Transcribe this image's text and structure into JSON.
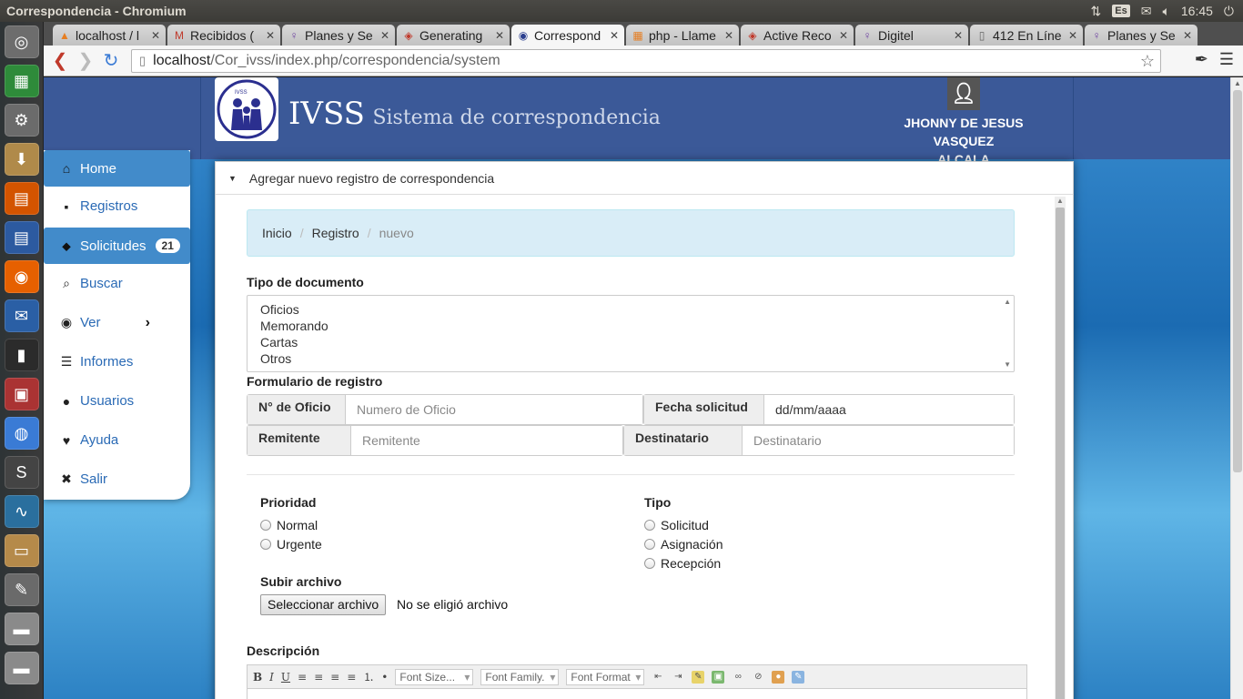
{
  "os": {
    "window_title": "Correspondencia - Chromium",
    "keyboard_layout": "Es",
    "clock": "16:45"
  },
  "launcher": {
    "items": [
      {
        "name": "ubuntu-dash-icon",
        "glyph": "◎",
        "color": "#6d6d6d"
      },
      {
        "name": "spreadsheet-icon",
        "glyph": "▦",
        "color": "#2e8b3a"
      },
      {
        "name": "settings-icon",
        "glyph": "⚙",
        "color": "#6b6b6b"
      },
      {
        "name": "files-download-icon",
        "glyph": "⬇",
        "color": "#b08a4a"
      },
      {
        "name": "presentation-icon",
        "glyph": "▤",
        "color": "#d35400"
      },
      {
        "name": "writer-icon",
        "glyph": "▤",
        "color": "#2c5aa0"
      },
      {
        "name": "firefox-icon",
        "glyph": "◉",
        "color": "#e66000"
      },
      {
        "name": "thunderbird-icon",
        "glyph": "✉",
        "color": "#2a5fa5"
      },
      {
        "name": "terminal-icon",
        "glyph": "▮",
        "color": "#2b2b2b"
      },
      {
        "name": "archive-icon",
        "glyph": "▣",
        "color": "#a33"
      },
      {
        "name": "chromium-icon",
        "glyph": "◍",
        "color": "#3a7bd5"
      },
      {
        "name": "sublime-icon",
        "glyph": "S",
        "color": "#444"
      },
      {
        "name": "system-monitor-icon",
        "glyph": "∿",
        "color": "#2a6f9e"
      },
      {
        "name": "package-icon",
        "glyph": "▭",
        "color": "#b58a4a"
      },
      {
        "name": "text-editor-icon",
        "glyph": "✎",
        "color": "#6a6a6a"
      },
      {
        "name": "drive-icon",
        "glyph": "▬",
        "color": "#8a8a8a"
      },
      {
        "name": "drive2-icon",
        "glyph": "▬",
        "color": "#8a8a8a"
      }
    ]
  },
  "browser": {
    "tabs": [
      {
        "label": "localhost / l",
        "fav": "▲",
        "favcolor": "#e67e22",
        "active": false
      },
      {
        "label": "Recibidos (",
        "fav": "M",
        "favcolor": "#c0392b",
        "active": false
      },
      {
        "label": "Planes y Se",
        "fav": "♀",
        "favcolor": "#6c3fa0",
        "active": false
      },
      {
        "label": "Generating",
        "fav": "◈",
        "favcolor": "#c0392b",
        "active": false
      },
      {
        "label": "Correspond",
        "fav": "◉",
        "favcolor": "#2b3f8f",
        "active": true
      },
      {
        "label": "php - Llame",
        "fav": "▦",
        "favcolor": "#e67e22",
        "active": false
      },
      {
        "label": "Active Reco",
        "fav": "◈",
        "favcolor": "#c0392b",
        "active": false
      },
      {
        "label": "Digitel",
        "fav": "♀",
        "favcolor": "#6c3fa0",
        "active": false
      },
      {
        "label": "412 En Líne",
        "fav": "▯",
        "favcolor": "#666",
        "active": false
      },
      {
        "label": "Planes y Se",
        "fav": "♀",
        "favcolor": "#6c3fa0",
        "active": false
      }
    ],
    "url_host": "localhost",
    "url_path": "/Cor_ivss/index.php/correspondencia/system"
  },
  "header": {
    "brand": "IVSS",
    "subtitle": "Sistema de correspondencia",
    "logo_text": "IVSS",
    "user_line1": "JHONNY DE JESUS VASQUEZ",
    "user_line2": "ALCALA"
  },
  "sidebar": {
    "items": [
      {
        "label": "Home",
        "icon": "home-icon",
        "glyph": "⌂",
        "active": true
      },
      {
        "label": "Registros",
        "icon": "save-icon",
        "glyph": "▪",
        "active": false
      },
      {
        "label": "Solicitudes",
        "icon": "tags-icon",
        "glyph": "⬥",
        "active": true,
        "badge": "21"
      },
      {
        "label": "Buscar",
        "icon": "search-icon",
        "glyph": "⌕",
        "active": false
      },
      {
        "label": "Ver",
        "icon": "eye-icon",
        "glyph": "◉",
        "active": false,
        "chevron": "›"
      },
      {
        "label": "Informes",
        "icon": "list-icon",
        "glyph": "☰",
        "active": false
      },
      {
        "label": "Usuarios",
        "icon": "user-icon",
        "glyph": "●",
        "active": false
      },
      {
        "label": "Ayuda",
        "icon": "heart-icon",
        "glyph": "♥",
        "active": false
      },
      {
        "label": "Salir",
        "icon": "close-icon",
        "glyph": "✖",
        "active": false
      }
    ]
  },
  "panel": {
    "heading": "Agregar nuevo registro de correspondencia",
    "breadcrumb": {
      "home": "Inicio",
      "section": "Registro",
      "current": "nuevo",
      "sep": "/"
    },
    "doc_type_label": "Tipo de documento",
    "doc_types": [
      "Oficios",
      "Memorando",
      "Cartas",
      "Otros"
    ],
    "form_label": "Formulario de registro",
    "fields": {
      "oficio_label": "N° de Oficio",
      "oficio_placeholder": "Numero de Oficio",
      "fecha_label": "Fecha solicitud",
      "fecha_value": "dd/mm/aaaa",
      "remitente_label": "Remitente",
      "remitente_placeholder": "Remitente",
      "destinatario_label": "Destinatario",
      "destinatario_placeholder": "Destinatario"
    },
    "prioridad_label": "Prioridad",
    "prioridad_options": [
      "Normal",
      "Urgente"
    ],
    "tipo_label": "Tipo",
    "tipo_options": [
      "Solicitud",
      "Asignación",
      "Recepción"
    ],
    "upload_label": "Subir archivo",
    "upload_button": "Seleccionar archivo",
    "upload_status": "No se eligió archivo",
    "descripcion_label": "Descripción",
    "editor": {
      "font_size": "Font Size...",
      "font_family": "Font Family.",
      "font_format": "Font Format"
    }
  }
}
